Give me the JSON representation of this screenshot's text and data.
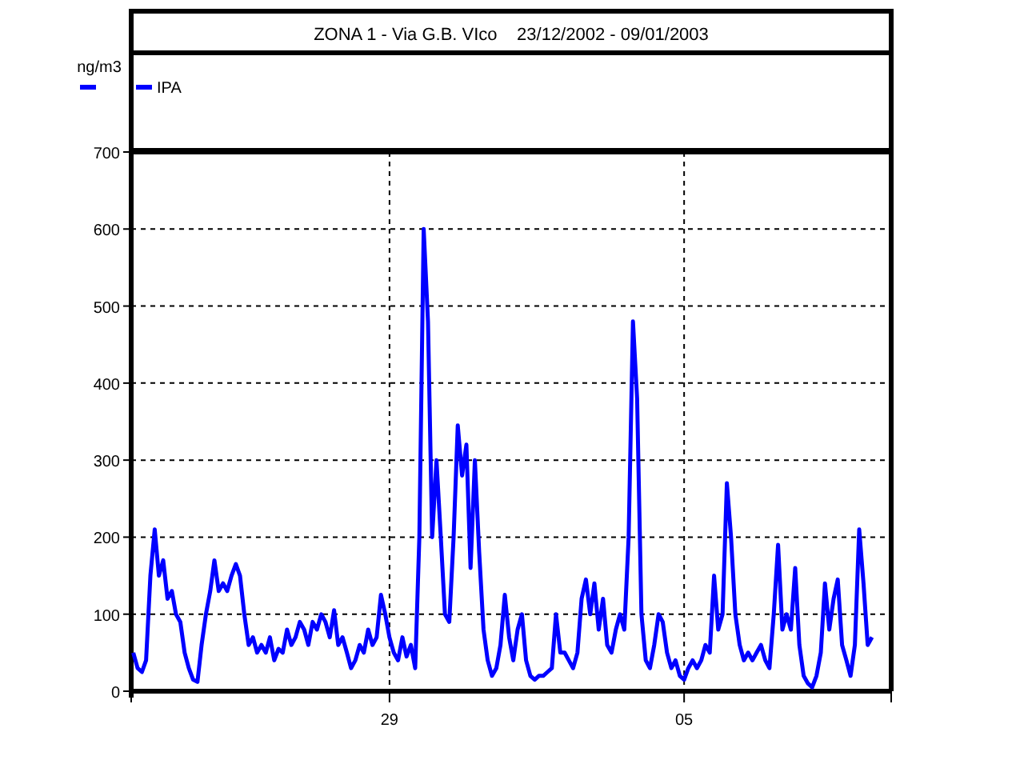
{
  "title": "ZONA 1 - Via G.B. VIco    23/12/2002 - 09/01/2003",
  "chart_data": {
    "type": "line",
    "ylabel": "ng/m3",
    "grid": true,
    "ylim": [
      0,
      700
    ],
    "yticks": [
      0,
      100,
      200,
      300,
      400,
      500,
      600,
      700
    ],
    "categories": [
      null,
      null,
      null,
      null,
      null,
      null,
      null,
      null,
      null,
      null,
      null,
      null,
      null,
      null,
      null,
      null,
      null,
      null,
      null,
      null,
      null,
      null,
      null,
      null,
      null,
      null,
      null,
      null,
      null,
      null,
      null,
      null,
      null,
      null,
      null,
      null,
      null,
      null,
      null,
      null,
      null,
      null,
      null,
      null,
      null,
      null,
      null,
      null,
      null,
      null,
      null,
      null,
      null,
      null,
      null,
      null,
      null,
      null,
      null,
      null,
      "29",
      null,
      null,
      null,
      null,
      null,
      null,
      null,
      null,
      null,
      null,
      null,
      null,
      null,
      null,
      null,
      null,
      null,
      null,
      null,
      null,
      null,
      null,
      null,
      null,
      null,
      null,
      null,
      null,
      null,
      null,
      null,
      null,
      null,
      null,
      null,
      null,
      null,
      null,
      null,
      null,
      null,
      null,
      null,
      null,
      null,
      null,
      null,
      null,
      null,
      null,
      null,
      null,
      null,
      null,
      null,
      null,
      null,
      null,
      null,
      null,
      null,
      null,
      null,
      null,
      null,
      null,
      null,
      null,
      "05",
      null,
      null,
      null,
      null,
      null,
      null,
      null,
      null,
      null,
      null,
      null,
      null,
      null,
      null,
      null,
      null,
      null,
      null,
      null,
      null,
      null,
      null,
      null,
      null,
      null,
      null,
      null,
      null,
      null,
      null,
      null,
      null,
      null,
      null,
      null,
      null,
      null,
      null,
      null,
      null,
      null,
      null,
      null,
      null
    ],
    "series": [
      {
        "name": "IPA",
        "color": "#0000ff",
        "values": [
          50,
          30,
          25,
          40,
          150,
          210,
          150,
          170,
          120,
          130,
          100,
          90,
          50,
          30,
          15,
          12,
          60,
          100,
          130,
          170,
          130,
          140,
          130,
          150,
          165,
          150,
          100,
          60,
          70,
          50,
          60,
          50,
          70,
          40,
          55,
          50,
          80,
          60,
          70,
          90,
          80,
          60,
          90,
          80,
          100,
          90,
          70,
          105,
          60,
          70,
          50,
          30,
          40,
          60,
          50,
          80,
          60,
          70,
          125,
          100,
          70,
          50,
          40,
          70,
          45,
          60,
          30,
          200,
          600,
          480,
          200,
          300,
          200,
          100,
          90,
          200,
          345,
          280,
          320,
          160,
          300,
          180,
          80,
          40,
          20,
          30,
          60,
          125,
          70,
          40,
          80,
          100,
          40,
          20,
          15,
          20,
          20,
          25,
          30,
          100,
          50,
          50,
          40,
          30,
          50,
          120,
          145,
          100,
          140,
          80,
          120,
          60,
          50,
          80,
          100,
          80,
          200,
          480,
          380,
          100,
          40,
          30,
          60,
          100,
          90,
          50,
          30,
          40,
          20,
          15,
          30,
          40,
          30,
          40,
          60,
          50,
          150,
          80,
          100,
          270,
          200,
          100,
          60,
          40,
          50,
          40,
          50,
          60,
          40,
          30,
          100,
          190,
          80,
          100,
          80,
          160,
          60,
          20,
          10,
          5,
          20,
          50,
          140,
          80,
          120,
          145,
          60,
          40,
          20,
          60,
          210,
          140,
          60,
          70
        ]
      }
    ]
  }
}
